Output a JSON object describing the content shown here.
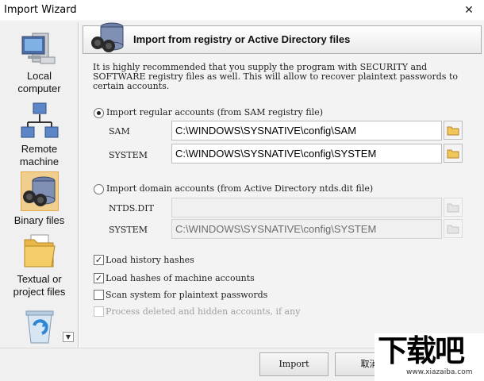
{
  "window": {
    "title": "Import Wizard",
    "close_glyph": "✕"
  },
  "sidebar": {
    "items": [
      {
        "label_line1": "Local",
        "label_line2": "computer",
        "icon": "computer-icon"
      },
      {
        "label_line1": "Remote",
        "label_line2": "machine",
        "icon": "network-icon"
      },
      {
        "label_line1": "Binary files",
        "label_line2": "",
        "icon": "database-icon",
        "selected": true
      },
      {
        "label_line1": "Textual or",
        "label_line2": "project files",
        "icon": "folder-icon"
      },
      {
        "label_line1": "",
        "label_line2": "",
        "icon": "recycle-bin-icon"
      }
    ],
    "scroll_glyph": "▼"
  },
  "header": {
    "title": "Import from registry or Active Directory files"
  },
  "intro": "It is highly recommended that you supply the program with SECURITY and SOFTWARE registry files as well. This will allow to recover plaintext passwords to certain accounts.",
  "sam_option": {
    "label": "Import regular accounts (from SAM registry file)",
    "selected": true,
    "sam_label": "SAM",
    "sam_value": "C:\\WINDOWS\\SYSNATIVE\\config\\SAM",
    "system_label": "SYSTEM",
    "system_value": "C:\\WINDOWS\\SYSNATIVE\\config\\SYSTEM"
  },
  "ad_option": {
    "label": "Import domain accounts (from Active Directory ntds.dit file)",
    "selected": false,
    "ntds_label": "NTDS.DIT",
    "ntds_value": "",
    "system_label": "SYSTEM",
    "system_value": "C:\\WINDOWS\\SYSNATIVE\\config\\SYSTEM"
  },
  "options": [
    {
      "label": "Load history hashes",
      "checked": true,
      "enabled": true
    },
    {
      "label": "Load hashes of machine accounts",
      "checked": true,
      "enabled": true
    },
    {
      "label": "Scan system for plaintext passwords",
      "checked": false,
      "enabled": true
    },
    {
      "label": "Process deleted and hidden accounts, if any",
      "checked": false,
      "enabled": false
    }
  ],
  "buttons": {
    "import": "Import",
    "cancel": "取消"
  },
  "watermark": {
    "big": "下载吧",
    "url": "www.xiazaiba.com"
  },
  "colors": {
    "selected_bg": "#f0ce8e",
    "folder": "#e8b94a"
  }
}
